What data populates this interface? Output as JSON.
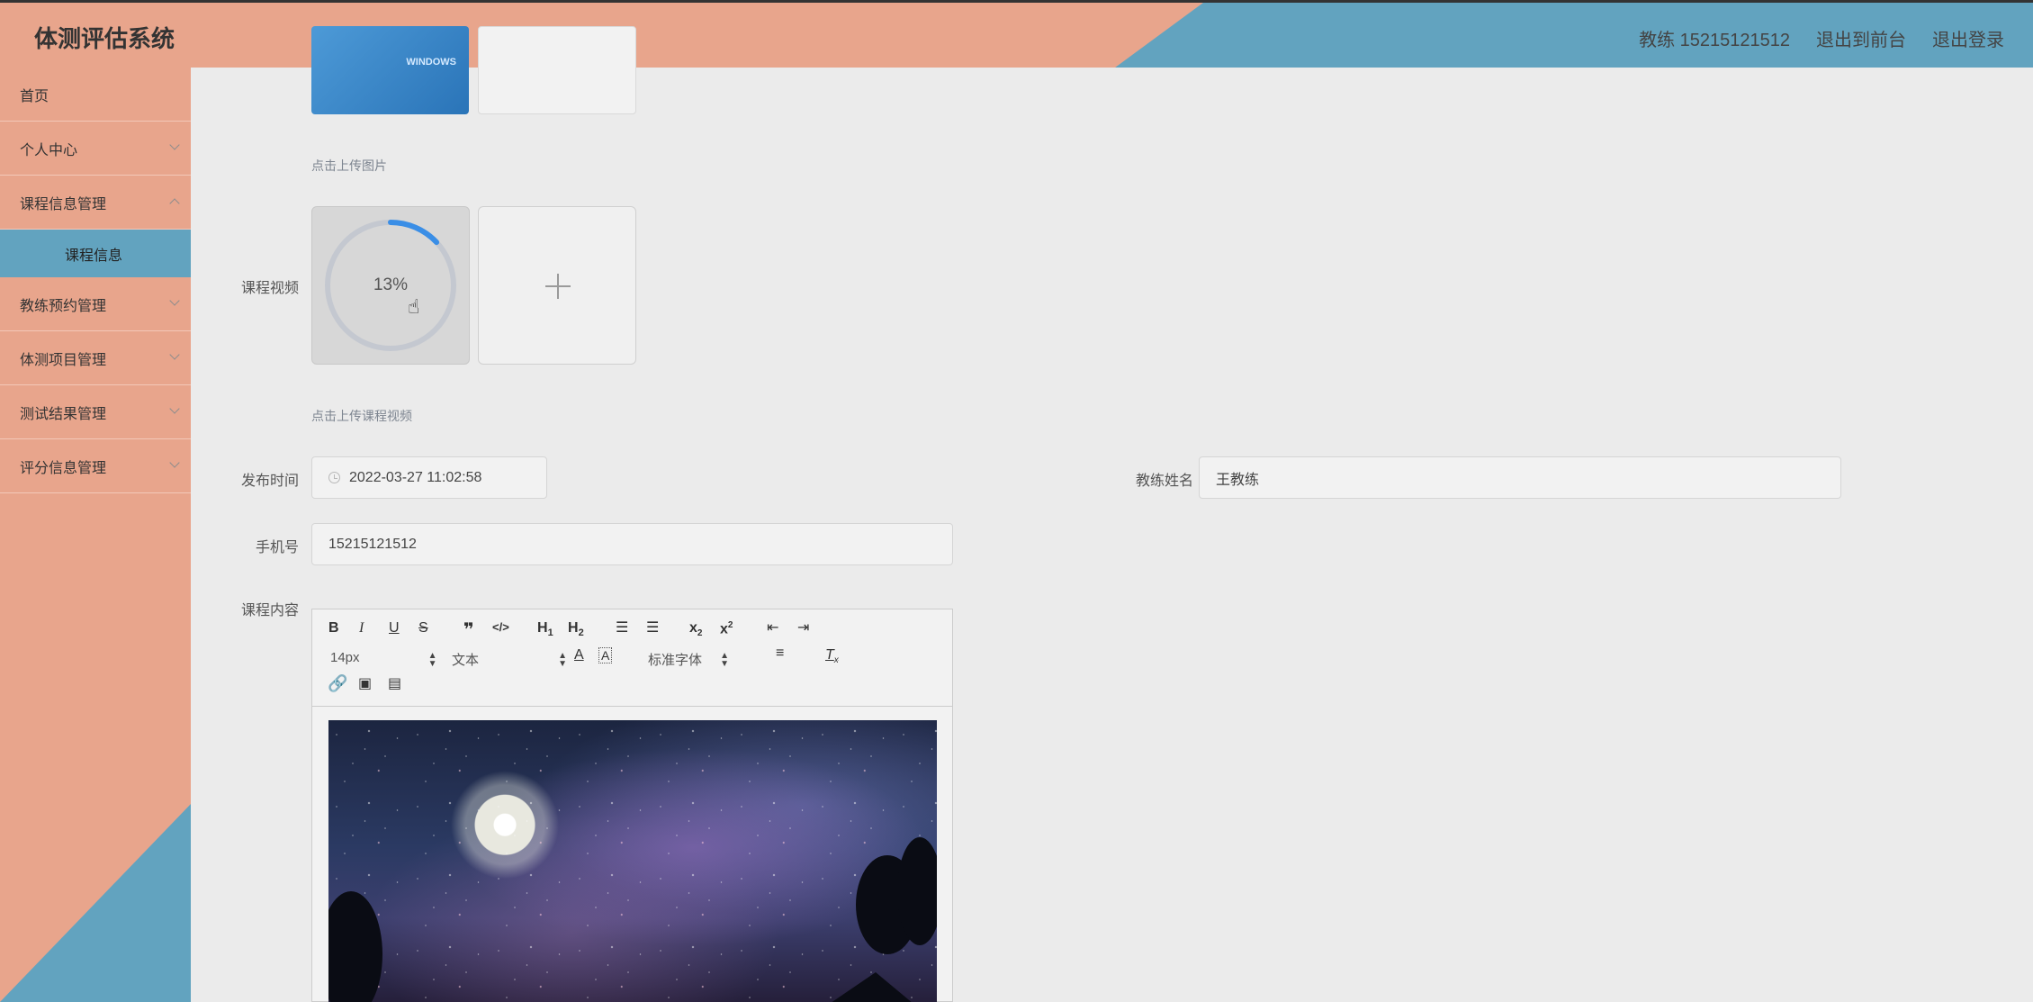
{
  "header": {
    "app_title": "体测评估系统",
    "user": "教练 15215121512",
    "to_front": "退出到前台",
    "logout": "退出登录"
  },
  "sidebar": {
    "items": [
      {
        "label": "首页"
      },
      {
        "label": "个人中心"
      },
      {
        "label": "课程信息管理"
      },
      {
        "label": "教练预约管理"
      },
      {
        "label": "体测项目管理"
      },
      {
        "label": "测试结果管理"
      },
      {
        "label": "评分信息管理"
      }
    ],
    "sub_item": "课程信息"
  },
  "form": {
    "image_thumb_text": "WINDOWS",
    "image_hint": "点击上传图片",
    "video_label": "课程视频",
    "video_progress": "13%",
    "video_progress_value": 0.13,
    "video_hint": "点击上传课程视频",
    "publish_time_label": "发布时间",
    "publish_time": "2022-03-27 11:02:58",
    "coach_name_label": "教练姓名",
    "coach_name": "王教练",
    "phone_label": "手机号",
    "phone": "15215121512",
    "content_label": "课程内容"
  },
  "editor": {
    "font_size": "14px",
    "block_type": "文本",
    "font_family": "标准字体",
    "buttons": [
      "B",
      "I",
      "U",
      "S",
      "❞",
      "</>",
      "H1",
      "H2",
      "ordered-list",
      "bullet-list",
      "x₂",
      "x²",
      "outdent",
      "indent",
      "A",
      "background-color",
      "align",
      "Tx",
      "link",
      "image",
      "video"
    ]
  },
  "colors": {
    "salmon": "#e8a58c",
    "steel_blue": "#62a3bf",
    "progress": "#3a8ee6"
  }
}
